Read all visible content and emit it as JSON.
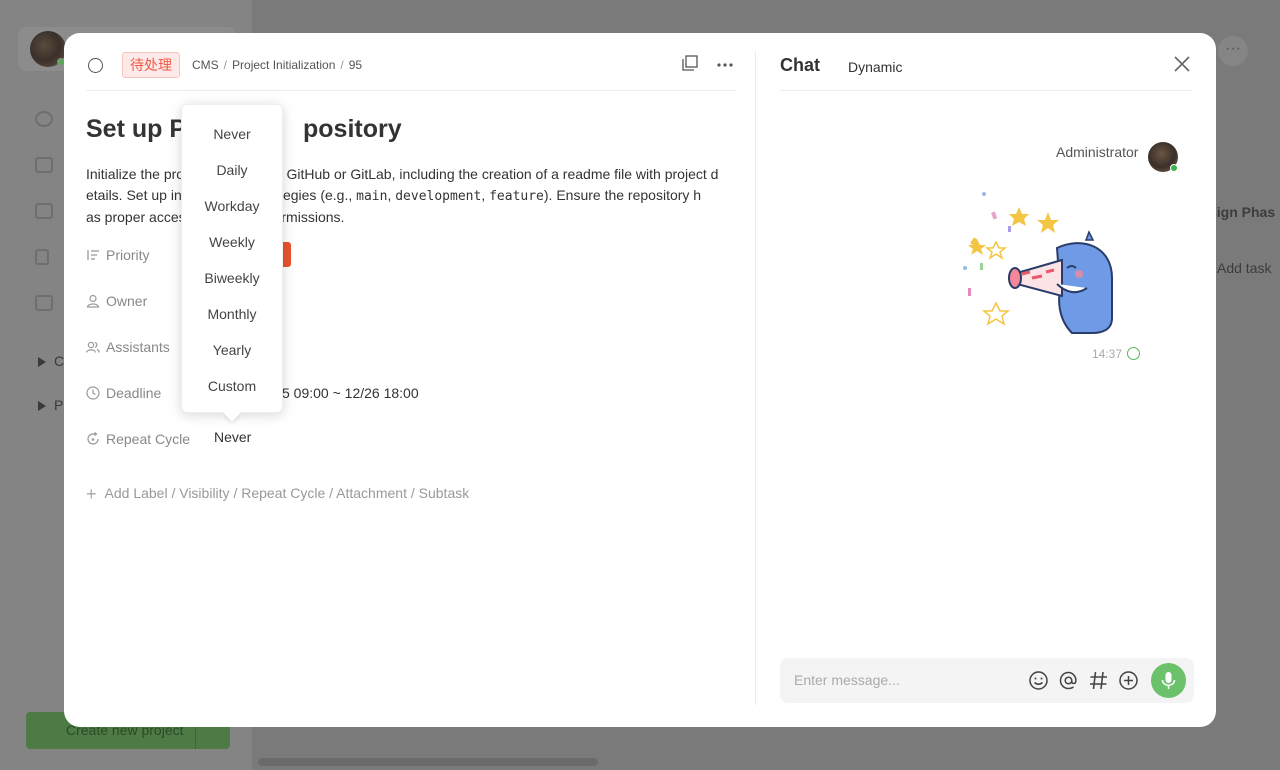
{
  "background": {
    "tree_items": [
      "C",
      "P"
    ],
    "create_button": "Create new project",
    "right_column_title": "sign Phas",
    "right_column_add": "Add task"
  },
  "task": {
    "status": "待处理",
    "breadcrumb": [
      "CMS",
      "Project Initialization",
      "95"
    ],
    "title": "Set up Project Repository",
    "title_visible": [
      "Set up P",
      "pository"
    ],
    "description_parts": {
      "line1a": "Initialize the pro",
      "line1b": "on GitHub or GitLab, including the creation of a readme file with project d",
      "line2a": "etails. Set up in",
      "line2b": "trategies (e.g., ",
      "code1": "main",
      "comma1": ", ",
      "code2": "development",
      "comma2": ", ",
      "code3": "feature",
      "line2c": "). Ensure the repository h",
      "line3a": "as proper acces",
      "line3b": "ermissions."
    },
    "fields": {
      "priority_label": "Priority",
      "owner_label": "Owner",
      "assistants_label": "Assistants",
      "deadline_label": "Deadline",
      "deadline_value": "5 09:00 ~ 12/26 18:00",
      "repeat_label": "Repeat Cycle",
      "repeat_value": "Never"
    },
    "add_fields": "Add Label / Visibility / Repeat Cycle / Attachment / Subtask"
  },
  "repeat_dropdown": {
    "options": [
      "Never",
      "Daily",
      "Workday",
      "Weekly",
      "Biweekly",
      "Monthly",
      "Yearly",
      "Custom"
    ]
  },
  "chat": {
    "tab_chat": "Chat",
    "tab_dynamic": "Dynamic",
    "messages": [
      {
        "sender": "Administrator",
        "type": "sticker",
        "time": "14:37"
      }
    ],
    "input_placeholder": "Enter message..."
  },
  "colors": {
    "status_red": "#ef5a47",
    "priority_orange": "#e8542f",
    "mic_green": "#6cc16b",
    "online_green": "#3cb34a"
  }
}
